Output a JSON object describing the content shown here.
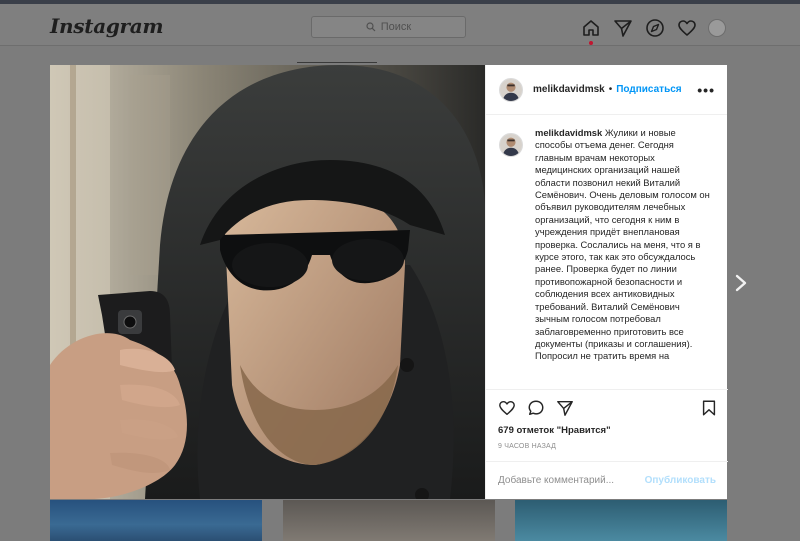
{
  "header": {
    "logo": "Instagram",
    "search_placeholder": "Поиск"
  },
  "post": {
    "username": "melikdavidmsk",
    "separator": "•",
    "follow_label": "Подписаться",
    "more_label": "•••",
    "caption_user": "melikdavidmsk",
    "caption_text": " Жулики и новые способы отъема денег. Сегодня главным врачам некоторых медицинских организаций нашей области позвонил некий Виталий Семёнович. Очень деловым голосом он объявил руководителям лечебных организаций, что сегодня к ним в учреждения придёт внеплановая проверка. Сослались на меня, что я в курсе этого, так как это обсуждалось ранее. Проверка будет по линии противопожарной безопасности и соблюдения всех антиковидных требований. Виталий Семёнович зычным голосом потребовал заблаговременно приготовить все документы (приказы и соглашения). Попросил не тратить время на",
    "likes": "679 отметок \"Нравится\"",
    "time": "9 ЧАСОВ НАЗАД",
    "comment_placeholder": "Добавьте комментарий...",
    "publish_label": "Опубликовать"
  },
  "colors": {
    "link": "#0095f6",
    "publish_disabled": "#b2dffc",
    "dim_overlay": "#7c7c7c"
  },
  "icons": [
    "search-icon",
    "home-icon",
    "direct-icon",
    "explore-icon",
    "heart-icon",
    "like-icon",
    "comment-icon",
    "share-icon",
    "bookmark-icon",
    "chevron-right-icon"
  ]
}
